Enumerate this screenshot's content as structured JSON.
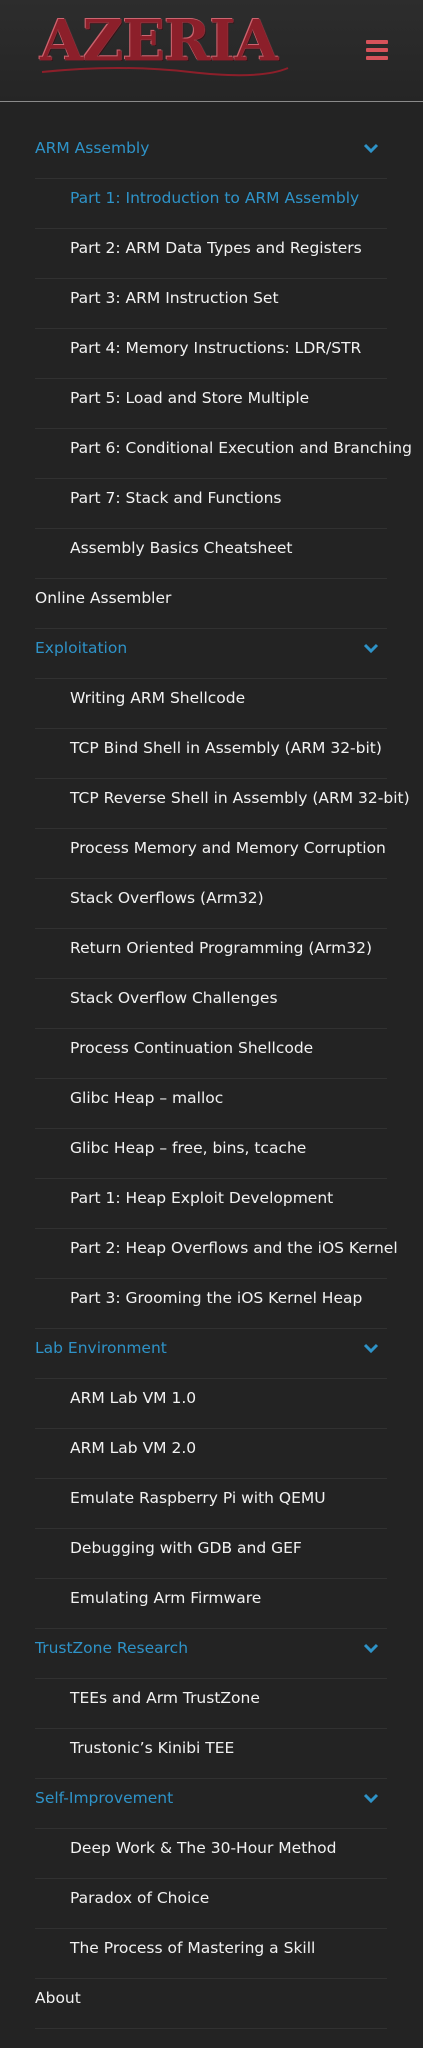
{
  "header": {
    "logo_text": "AZERIA",
    "menu_icon": "hamburger-menu-icon",
    "menu_color": "#d6525a",
    "logo_color": "#8c1f2a"
  },
  "colors": {
    "background": "#232323",
    "link_blue": "#2e93c8",
    "text": "#f2f2f2",
    "divider": "#313131"
  },
  "menu": [
    {
      "label": "ARM Assembly",
      "level": "top",
      "style": "blue",
      "expand_icon": "chevron-down-icon"
    },
    {
      "label": "Part 1: Introduction to ARM Assembly",
      "level": "sub",
      "style": "active"
    },
    {
      "label": "Part 2: ARM Data Types and Registers",
      "level": "sub"
    },
    {
      "label": "Part 3: ARM Instruction Set",
      "level": "sub"
    },
    {
      "label": "Part 4: Memory Instructions: LDR/STR",
      "level": "sub"
    },
    {
      "label": "Part 5: Load and Store Multiple",
      "level": "sub"
    },
    {
      "label": "Part 6: Conditional Execution and Branching",
      "level": "sub"
    },
    {
      "label": "Part 7: Stack and Functions",
      "level": "sub"
    },
    {
      "label": "Assembly Basics Cheatsheet",
      "level": "sub"
    },
    {
      "label": "Online Assembler",
      "level": "top"
    },
    {
      "label": "Exploitation",
      "level": "top",
      "style": "blue",
      "expand_icon": "chevron-down-icon"
    },
    {
      "label": "Writing ARM Shellcode",
      "level": "sub"
    },
    {
      "label": "TCP Bind Shell in Assembly (ARM 32-bit)",
      "level": "sub"
    },
    {
      "label": "TCP Reverse Shell in Assembly (ARM 32-bit)",
      "level": "sub"
    },
    {
      "label": "Process Memory and Memory Corruption",
      "level": "sub"
    },
    {
      "label": "Stack Overflows (Arm32)",
      "level": "sub"
    },
    {
      "label": "Return Oriented Programming (Arm32)",
      "level": "sub"
    },
    {
      "label": "Stack Overflow Challenges",
      "level": "sub"
    },
    {
      "label": "Process Continuation Shellcode",
      "level": "sub"
    },
    {
      "label": "Glibc Heap – malloc",
      "level": "sub"
    },
    {
      "label": "Glibc Heap – free, bins, tcache",
      "level": "sub"
    },
    {
      "label": "Part 1: Heap Exploit Development",
      "level": "sub"
    },
    {
      "label": "Part 2: Heap Overflows and the iOS Kernel",
      "level": "sub"
    },
    {
      "label": "Part 3: Grooming the iOS Kernel Heap",
      "level": "sub"
    },
    {
      "label": "Lab Environment",
      "level": "top",
      "style": "blue",
      "expand_icon": "chevron-down-icon"
    },
    {
      "label": "ARM Lab VM 1.0",
      "level": "sub"
    },
    {
      "label": "ARM Lab VM 2.0",
      "level": "sub"
    },
    {
      "label": "Emulate Raspberry Pi with QEMU",
      "level": "sub"
    },
    {
      "label": "Debugging with GDB and GEF",
      "level": "sub"
    },
    {
      "label": "Emulating Arm Firmware",
      "level": "sub"
    },
    {
      "label": "TrustZone Research",
      "level": "top",
      "style": "blue",
      "expand_icon": "chevron-down-icon"
    },
    {
      "label": "TEEs and Arm TrustZone",
      "level": "sub"
    },
    {
      "label": "Trustonic’s Kinibi TEE",
      "level": "sub"
    },
    {
      "label": "Self-Improvement",
      "level": "top",
      "style": "blue",
      "expand_icon": "chevron-down-icon"
    },
    {
      "label": "Deep Work & The 30-Hour Method",
      "level": "sub"
    },
    {
      "label": "Paradox of Choice",
      "level": "sub"
    },
    {
      "label": "The Process of Mastering a Skill",
      "level": "sub"
    },
    {
      "label": "About",
      "level": "top"
    }
  ]
}
